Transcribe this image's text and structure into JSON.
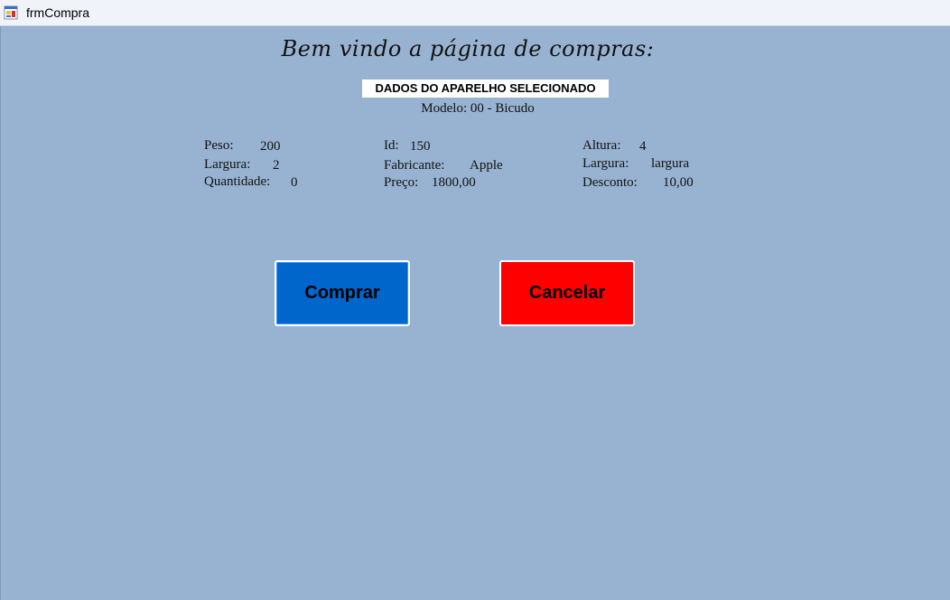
{
  "window": {
    "title": "frmCompra"
  },
  "header": {
    "welcome": "Bem vindo a página de compras:",
    "section_title": "DADOS DO APARELHO SELECIONADO",
    "modelo": "Modelo: 00 - Bicudo"
  },
  "fields": {
    "peso": {
      "label": "Peso:",
      "value": "200"
    },
    "largura_left": {
      "label": "Largura:",
      "value": "2"
    },
    "quantidade": {
      "label": "Quantidade:",
      "value": "0"
    },
    "id": {
      "label": "Id:",
      "value": "150"
    },
    "fabricante": {
      "label": "Fabricante:",
      "value": "Apple"
    },
    "preco": {
      "label": "Preço:",
      "value": "1800,00"
    },
    "altura": {
      "label": "Altura:",
      "value": "4"
    },
    "largura_right": {
      "label": "Largura:",
      "value": "largura"
    },
    "desconto": {
      "label": "Desconto:",
      "value": "10,00"
    }
  },
  "buttons": {
    "comprar": "Comprar",
    "cancelar": "Cancelar"
  },
  "colors": {
    "background": "#98B3D1",
    "comprar": "#0066CC",
    "cancelar": "#FF0000"
  },
  "icons": {
    "app": "winforms-app-icon"
  }
}
